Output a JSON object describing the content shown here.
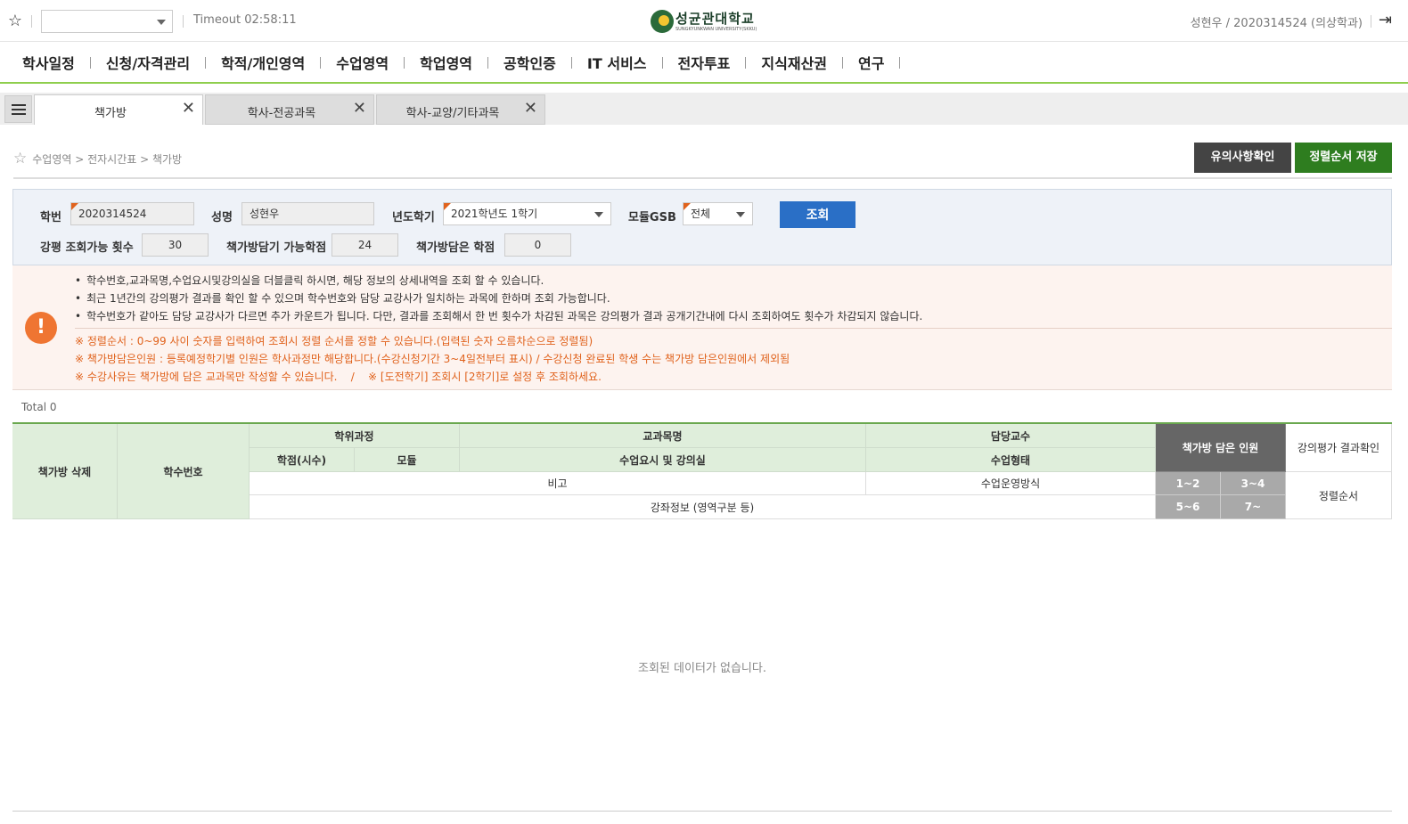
{
  "topbar": {
    "timeout": "Timeout 02:58:11",
    "logo_name": "성균관대학교",
    "logo_sub": "SUNGKYUNKWAN UNIVERSITY(SKKU)",
    "user": "성현우 / 2020314524 (의상학과)"
  },
  "nav": [
    "학사일정",
    "신청/자격관리",
    "학적/개인영역",
    "수업영역",
    "학업영역",
    "공학인증",
    "IT 서비스",
    "전자투표",
    "지식재산권",
    "연구"
  ],
  "tabs": [
    {
      "label": "책가방"
    },
    {
      "label": "학사-전공과목"
    },
    {
      "label": "학사-교양/기타과목"
    }
  ],
  "breadcrumb": "수업영역 > 전자시간표 > 책가방",
  "buttons": {
    "notice": "유의사항확인",
    "save_order": "정렬순서 저장",
    "search": "조회"
  },
  "search": {
    "student_id_label": "학번",
    "student_id": "2020314524",
    "name_label": "성명",
    "name": "성현우",
    "term_label": "년도학기",
    "term": "2021학년도 1학기",
    "module_label": "모듈GSB",
    "module": "전체",
    "eval_count_label": "강평 조회가능 횟수",
    "eval_count": "30",
    "credits_avail_label": "책가방담기 가능학점",
    "credits_avail": "24",
    "credits_in_label": "책가방담은 학점",
    "credits_in": "0"
  },
  "info": {
    "bullets": [
      "학수번호,교과목명,수업요시및강의실을 더블클릭 하시면, 해당 정보의 상세내역을 조회 할 수 있습니다.",
      "최근 1년간의 강의평가 결과를 확인 할 수 있으며 학수번호와 담당 교강사가 일치하는 과목에 한하며 조회 가능합니다.",
      "학수번호가 같아도 담당 교강사가 다르면 추가 카운트가 됩니다. 다만, 결과를 조회해서 한 번 횟수가 차감된 과목은 강의평가 결과 공개기간내에 다시 조회하여도 횟수가 차감되지 않습니다."
    ],
    "notes": [
      "※ 정렬순서 : 0~99 사이 숫자를 입력하여 조회시 정렬 순서를 정할 수 있습니다.(입력된 숫자 오름차순으로 정렬됨)",
      "※ 책가방담은인원 : 등록예정학기별 인원은 학사과정만 해당합니다.(수강신청기간 3~4일전부터 표시) / 수강신청 완료된 학생 수는 책가방 담은인원에서 제외됨",
      "※ 수강사유는 책가방에 담은 교과목만 작성할 수 있습니다.    /    ※ [도전학기] 조회시 [2학기]로 설정 후 조회하세요."
    ]
  },
  "total": "Total 0",
  "grid": {
    "delete": "책가방 삭제",
    "course_no": "학수번호",
    "degree": "학위과정",
    "course_name": "교과목명",
    "professor": "담당교수",
    "bag_count": "책가방 담은 인원",
    "eval_result": "강의평가 결과확인",
    "credits": "학점(시수)",
    "module": "모듈",
    "schedule_room": "수업요시 및 강의실",
    "class_type": "수업형태",
    "remarks": "비고",
    "operation": "수업운영방식",
    "r12": "1~2",
    "r34": "3~4",
    "r56": "5~6",
    "r7": "7~",
    "sort_order": "정렬순서",
    "lecture_info": "강좌정보 (영역구분 등)",
    "empty": "조회된 데이터가 없습니다."
  }
}
